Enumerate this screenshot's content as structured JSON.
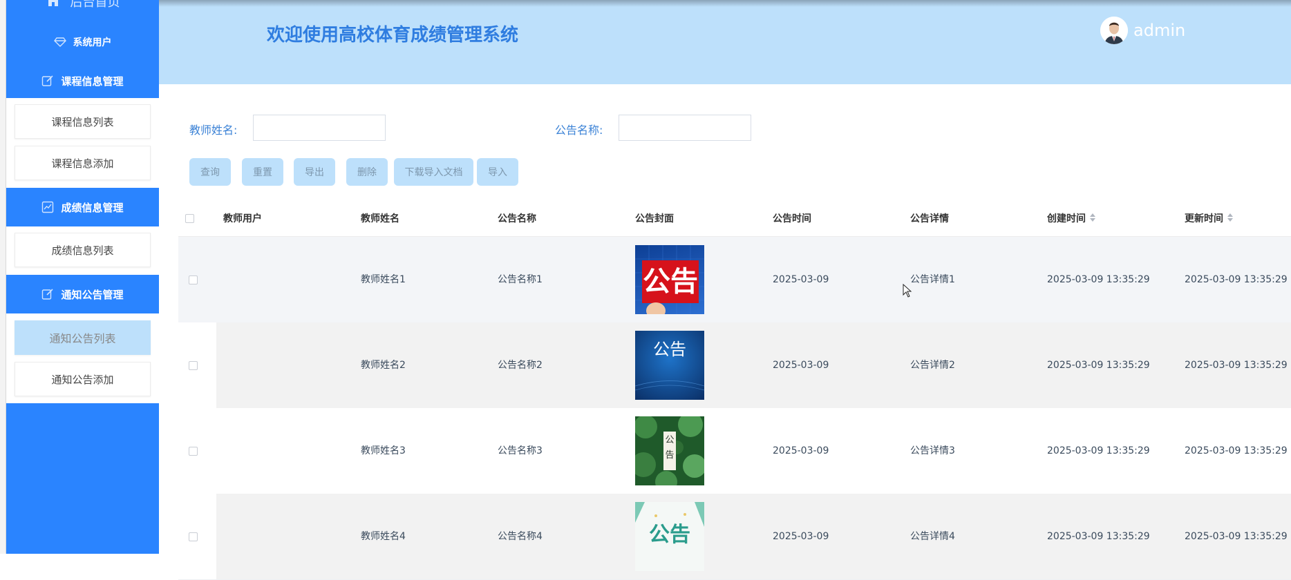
{
  "sidebar": {
    "top_partial": "后台首页",
    "items": [
      {
        "label": "系统用户",
        "icon": "diamond-icon"
      },
      {
        "label": "课程信息管理",
        "icon": "edit-icon"
      },
      {
        "label": "成绩信息管理",
        "icon": "chart-icon"
      },
      {
        "label": "通知公告管理",
        "icon": "edit-icon"
      }
    ],
    "course_sub": [
      "课程信息列表",
      "课程信息添加"
    ],
    "score_sub": [
      "成绩信息列表"
    ],
    "notice_sub": [
      "通知公告列表",
      "通知公告添加"
    ]
  },
  "header": {
    "title": "欢迎使用高校体育成绩管理系统",
    "username": "admin"
  },
  "search": {
    "teacher_label": "教师姓名:",
    "teacher_value": "",
    "notice_label": "公告名称:",
    "notice_value": ""
  },
  "toolbar": {
    "query": "查询",
    "reset": "重置",
    "export": "导出",
    "delete": "删除",
    "download_template": "下载导入文档",
    "import": "导入"
  },
  "table": {
    "columns": [
      "教师用户",
      "教师姓名",
      "公告名称",
      "公告封面",
      "公告时间",
      "公告详情",
      "创建时间",
      "更新时间"
    ],
    "rows": [
      {
        "teacher_user": "",
        "teacher_name": "教师姓名1",
        "notice_name": "公告名称1",
        "cover_text": "公告",
        "notice_time": "2025-03-09",
        "detail": "公告详情1",
        "created": "2025-03-09 13:35:29",
        "updated": "2025-03-09 13:35:29"
      },
      {
        "teacher_user": "",
        "teacher_name": "教师姓名2",
        "notice_name": "公告名称2",
        "cover_text": "公告",
        "notice_time": "2025-03-09",
        "detail": "公告详情2",
        "created": "2025-03-09 13:35:29",
        "updated": "2025-03-09 13:35:29"
      },
      {
        "teacher_user": "",
        "teacher_name": "教师姓名3",
        "notice_name": "公告名称3",
        "cover_text": "公告",
        "notice_time": "2025-03-09",
        "detail": "公告详情3",
        "created": "2025-03-09 13:35:29",
        "updated": "2025-03-09 13:35:29"
      },
      {
        "teacher_user": "",
        "teacher_name": "教师姓名4",
        "notice_name": "公告名称4",
        "cover_text": "公告",
        "notice_time": "2025-03-09",
        "detail": "公告详情4",
        "created": "2025-03-09 13:35:29",
        "updated": "2025-03-09 13:35:29"
      }
    ]
  },
  "colors": {
    "sidebar": "#2a84ff",
    "header": "#bde0fb",
    "accent_text": "#2f7de0"
  }
}
